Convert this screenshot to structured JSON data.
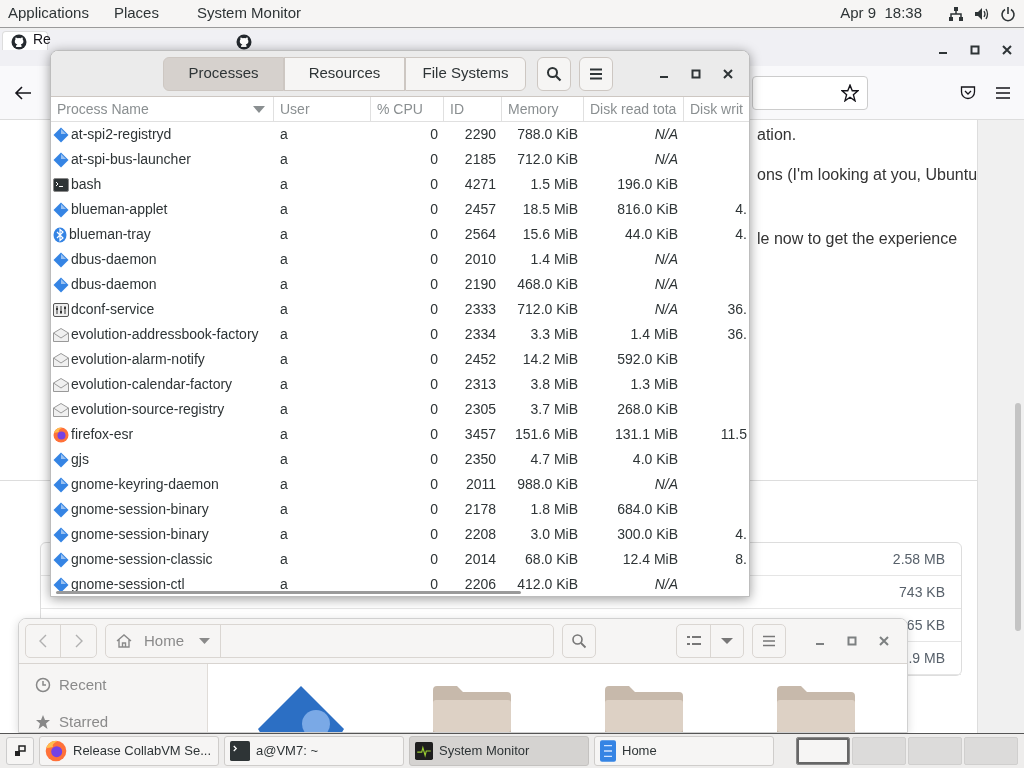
{
  "top_bar": {
    "menus": [
      "Applications",
      "Places",
      "System Monitor"
    ],
    "clock": "Apr 9  18:38"
  },
  "browser": {
    "tabs": [
      {
        "title": "Re",
        "selected": true
      },
      {
        "selected": false
      }
    ],
    "content_fragments": [
      {
        "text": "ation."
      },
      {
        "text": "ons (I'm looking at you, Ubuntu"
      },
      {
        "text": "le now to get the experience"
      }
    ],
    "file_sizes": [
      "2.58 MB",
      "743 KB",
      "65 KB",
      ".9 MB"
    ]
  },
  "system_monitor": {
    "tabs": [
      {
        "label": "Processes",
        "selected": true
      },
      {
        "label": "Resources",
        "selected": false
      },
      {
        "label": "File Systems",
        "selected": false
      }
    ],
    "columns": [
      "Process Name",
      "User",
      "% CPU",
      "ID",
      "Memory",
      "Disk read tota",
      "Disk writ"
    ],
    "rows": [
      {
        "kind": "diamond",
        "name": "at-spi2-registryd",
        "user": "a",
        "cpu": "0",
        "id": "2290",
        "memory": "788.0 KiB",
        "disk_read": "N/A",
        "read_unavailable": true
      },
      {
        "kind": "diamond",
        "name": "at-spi-bus-launcher",
        "user": "a",
        "cpu": "0",
        "id": "2185",
        "memory": "712.0 KiB",
        "disk_read": "N/A",
        "read_unavailable": true
      },
      {
        "kind": "terminal",
        "name": "bash",
        "user": "a",
        "cpu": "0",
        "id": "4271",
        "memory": "1.5 MiB",
        "disk_read": "196.0 KiB",
        "read_unavailable": false
      },
      {
        "kind": "diamond",
        "name": "blueman-applet",
        "user": "a",
        "cpu": "0",
        "id": "2457",
        "memory": "18.5 MiB",
        "disk_read": "816.0 KiB",
        "read_unavailable": false,
        "disk_write": "4."
      },
      {
        "kind": "bluetooth",
        "name": "blueman-tray",
        "user": "a",
        "cpu": "0",
        "id": "2564",
        "memory": "15.6 MiB",
        "disk_read": "44.0 KiB",
        "read_unavailable": false,
        "disk_write": "4."
      },
      {
        "kind": "diamond",
        "name": "dbus-daemon",
        "user": "a",
        "cpu": "0",
        "id": "2010",
        "memory": "1.4 MiB",
        "disk_read": "N/A",
        "read_unavailable": true
      },
      {
        "kind": "diamond",
        "name": "dbus-daemon",
        "user": "a",
        "cpu": "0",
        "id": "2190",
        "memory": "468.0 KiB",
        "disk_read": "N/A",
        "read_unavailable": true
      },
      {
        "kind": "settings",
        "name": "dconf-service",
        "user": "a",
        "cpu": "0",
        "id": "2333",
        "memory": "712.0 KiB",
        "disk_read": "N/A",
        "read_unavailable": true,
        "disk_write": "36."
      },
      {
        "kind": "mail",
        "name": "evolution-addressbook-factory",
        "user": "a",
        "cpu": "0",
        "id": "2334",
        "memory": "3.3 MiB",
        "disk_read": "1.4 MiB",
        "read_unavailable": false,
        "disk_write": "36."
      },
      {
        "kind": "mail",
        "name": "evolution-alarm-notify",
        "user": "a",
        "cpu": "0",
        "id": "2452",
        "memory": "14.2 MiB",
        "disk_read": "592.0 KiB",
        "read_unavailable": false
      },
      {
        "kind": "mail",
        "name": "evolution-calendar-factory",
        "user": "a",
        "cpu": "0",
        "id": "2313",
        "memory": "3.8 MiB",
        "disk_read": "1.3 MiB",
        "read_unavailable": false
      },
      {
        "kind": "mail",
        "name": "evolution-source-registry",
        "user": "a",
        "cpu": "0",
        "id": "2305",
        "memory": "3.7 MiB",
        "disk_read": "268.0 KiB",
        "read_unavailable": false
      },
      {
        "kind": "browser",
        "name": "firefox-esr",
        "user": "a",
        "cpu": "0",
        "id": "3457",
        "memory": "151.6 MiB",
        "disk_read": "131.1 MiB",
        "read_unavailable": false,
        "disk_write": "11.5"
      },
      {
        "kind": "diamond",
        "name": "gjs",
        "user": "a",
        "cpu": "0",
        "id": "2350",
        "memory": "4.7 MiB",
        "disk_read": "4.0 KiB",
        "read_unavailable": false
      },
      {
        "kind": "diamond",
        "name": "gnome-keyring-daemon",
        "user": "a",
        "cpu": "0",
        "id": "2011",
        "memory": "988.0 KiB",
        "disk_read": "N/A",
        "read_unavailable": true
      },
      {
        "kind": "diamond",
        "name": "gnome-session-binary",
        "user": "a",
        "cpu": "0",
        "id": "2178",
        "memory": "1.8 MiB",
        "disk_read": "684.0 KiB",
        "read_unavailable": false
      },
      {
        "kind": "diamond",
        "name": "gnome-session-binary",
        "user": "a",
        "cpu": "0",
        "id": "2208",
        "memory": "3.0 MiB",
        "disk_read": "300.0 KiB",
        "read_unavailable": false,
        "disk_write": "4."
      },
      {
        "kind": "diamond",
        "name": "gnome-session-classic",
        "user": "a",
        "cpu": "0",
        "id": "2014",
        "memory": "68.0 KiB",
        "disk_read": "12.4 MiB",
        "read_unavailable": false,
        "disk_write": "8."
      },
      {
        "kind": "diamond",
        "name": "gnome-session-ctl",
        "user": "a",
        "cpu": "0",
        "id": "2206",
        "memory": "412.0 KiB",
        "disk_read": "N/A",
        "read_unavailable": true
      }
    ]
  },
  "files": {
    "location": "Home",
    "places": [
      {
        "kind": "recent",
        "label": "Recent"
      },
      {
        "kind": "starred",
        "label": "Starred"
      }
    ]
  },
  "taskbar": {
    "windows": [
      {
        "kind": "browser",
        "title": "Release CollabVM Se...",
        "selected": false
      },
      {
        "kind": "terminal",
        "title": "a@VM7: ~",
        "selected": false
      },
      {
        "kind": "monitor",
        "title": "System Monitor",
        "selected": true
      },
      {
        "kind": "files",
        "title": "Home",
        "selected": false
      }
    ],
    "workspaces": [
      {
        "selected": true
      },
      {
        "selected": false
      },
      {
        "selected": false
      },
      {
        "selected": false
      }
    ]
  }
}
